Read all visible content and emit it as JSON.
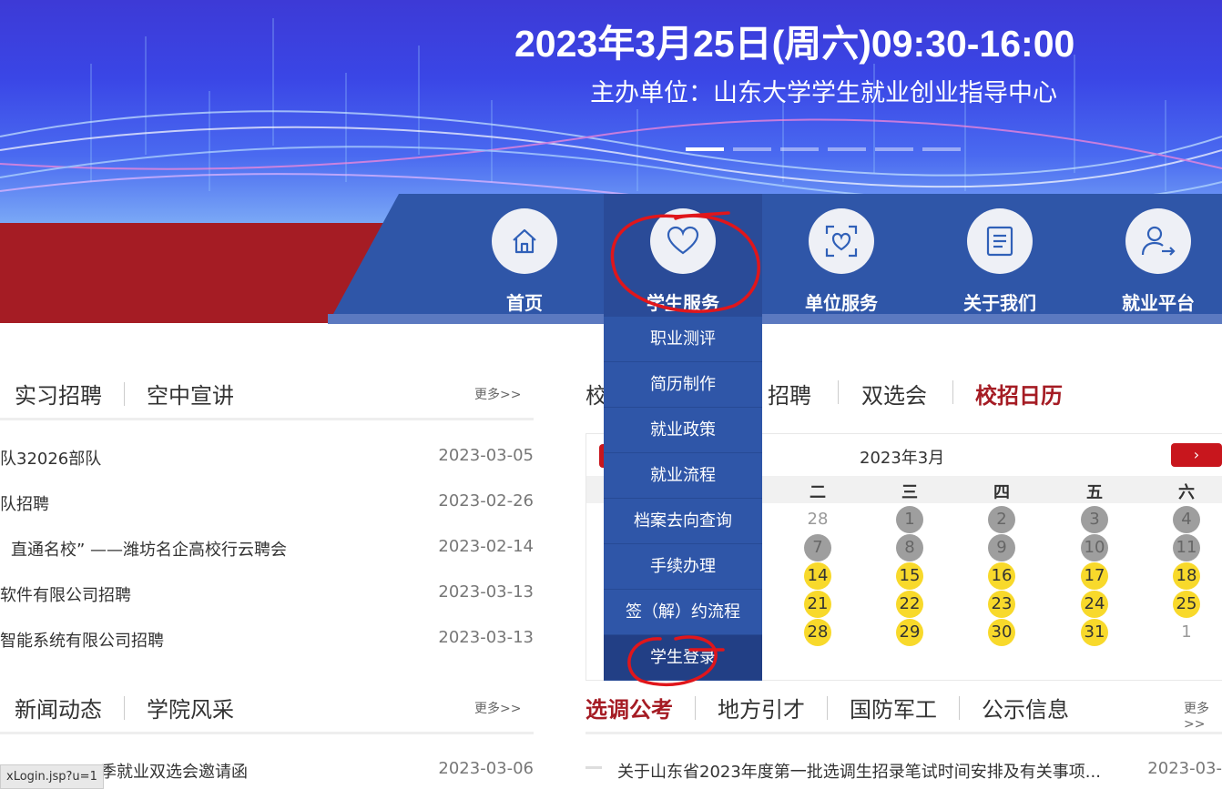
{
  "banner": {
    "date_text": "2023年3月25日(周六)09:30-16:00",
    "organizer": "主办单位：山东大学学生就业创业指导中心"
  },
  "nav": {
    "items": [
      {
        "label": "首页",
        "icon": "home-icon"
      },
      {
        "label": "学生服务",
        "icon": "heart-icon"
      },
      {
        "label": "单位服务",
        "icon": "scan-heart-icon"
      },
      {
        "label": "关于我们",
        "icon": "document-icon"
      },
      {
        "label": "就业平台",
        "icon": "user-login-icon"
      }
    ],
    "dropdown": [
      "职业测评",
      "简历制作",
      "就业政策",
      "就业流程",
      "档案去向查询",
      "手续办理",
      "签（解）约流程",
      "学生登录"
    ]
  },
  "panel_left_top": {
    "tabs": [
      "实习招聘",
      "空中宣讲"
    ],
    "more": "更多>>",
    "rows": [
      {
        "title": "队32026部队",
        "date": "2023-03-05"
      },
      {
        "title": "队招聘",
        "date": "2023-02-26"
      },
      {
        "title": "直通名校” ——潍坊名企高校行云聘会",
        "date": "2023-02-14"
      },
      {
        "title": "软件有限公司招聘",
        "date": "2023-03-13"
      },
      {
        "title": "智能系统有限公司招聘",
        "date": "2023-03-13"
      }
    ]
  },
  "panel_left_bottom": {
    "tabs": [
      "新闻动态",
      "学院风采"
    ],
    "more": "更多>>",
    "rows": [
      {
        "title": "季就业双选会邀请函",
        "date": "2023-03-06"
      }
    ]
  },
  "panel_right_top": {
    "tabs": [
      "校",
      "招聘",
      "双选会",
      "校招日历"
    ]
  },
  "calendar": {
    "title": "2023年3月",
    "next": "›",
    "weekdays": [
      "二",
      "三",
      "四",
      "五",
      "六"
    ],
    "rows": [
      [
        "28",
        "1",
        "2",
        "3",
        "4"
      ],
      [
        "7",
        "8",
        "9",
        "10",
        "11"
      ],
      [
        "14",
        "15",
        "16",
        "17",
        "18"
      ],
      [
        "21",
        "22",
        "23",
        "24",
        "25"
      ],
      [
        "28",
        "29",
        "30",
        "31",
        "1"
      ]
    ]
  },
  "panel_right_bottom": {
    "tabs": [
      "选调公考",
      "地方引才",
      "国防军工",
      "公示信息"
    ],
    "more": "更多>>",
    "rows": [
      {
        "title": "关于山东省2023年度第一批选调生招录笔试时间安排及有关事项...",
        "date": "2023-03-"
      }
    ]
  },
  "status_url": "xLogin.jsp?u=1",
  "colors": {
    "nav_blue": "#2f56a8",
    "brand_red": "#a51c24",
    "calendar_yellow": "#f8d92b"
  }
}
